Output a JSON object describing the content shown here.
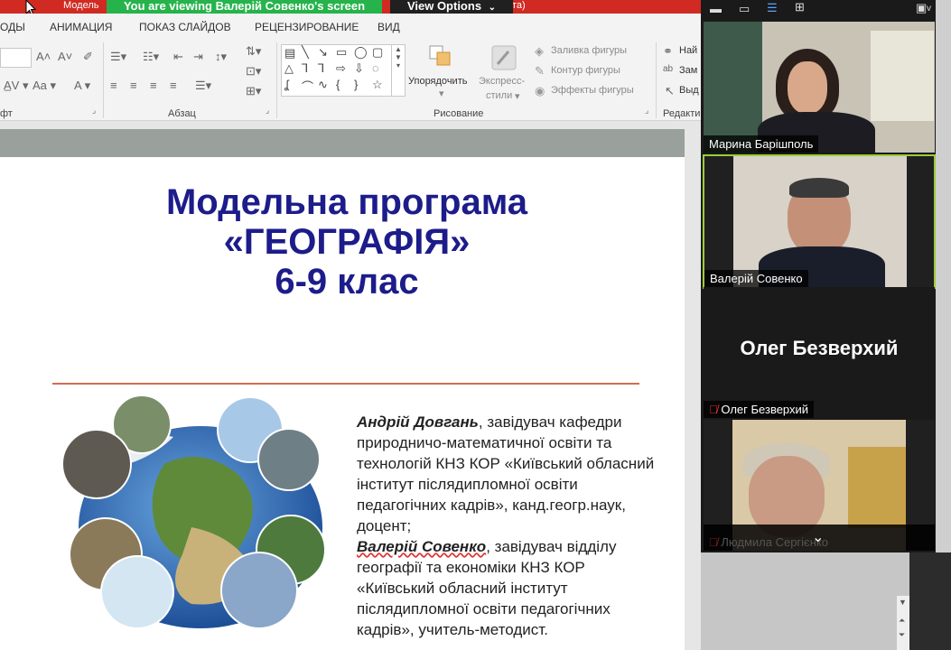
{
  "titlebar": {
    "left_text": "Модель",
    "right_text": "кта)"
  },
  "share": {
    "banner": "You are viewing Валерій Совенко's screen",
    "view_options": "View Options"
  },
  "ribbon": {
    "tabs": [
      "ОДЫ",
      "АНИМАЦИЯ",
      "ПОКАЗ СЛАЙДОВ",
      "РЕЦЕНЗИРОВАНИЕ",
      "ВИД"
    ],
    "groups": {
      "font_label": "фт",
      "paragraph_label": "Абзац",
      "drawing_label": "Рисование",
      "edit_label": "Редакти"
    },
    "buttons": {
      "arrange": "Упорядочить",
      "quick_styles_1": "Экспресс-",
      "quick_styles_2": "стили",
      "shape_fill": "Заливка фигуры",
      "shape_outline": "Контур фигуры",
      "shape_effects": "Эффекты фигуры",
      "find": "Най",
      "replace": "Зам",
      "select": "Выд"
    }
  },
  "slide": {
    "title_line1": "Модельна програма",
    "title_line2": "«ГЕОГРАФІЯ»",
    "title_line3": "6-9 клас",
    "author1_name": "Андрій Довгань",
    "author1_desc": ", завідувач кафедри природничо-математичної освіти та технологій КНЗ КОР «Київський обласний інститут післядипломної освіти педагогічних кадрів», канд.геогр.наук, доцент;",
    "author2_name": "Валерій Совенко",
    "author2_desc": ", завідувач відділу географії та економіки КНЗ КОР «Київський обласний інститут післядипломної освіти педагогічних кадрів», учитель-методист."
  },
  "zoom": {
    "participants": [
      {
        "name": "Марина Барішполь",
        "muted": false
      },
      {
        "name": "Валерій Совенко",
        "muted": false,
        "active_speaker": true
      },
      {
        "name": "Олег Безверхий",
        "muted": true,
        "video_off": true,
        "big_name": "Олег Безверхий"
      },
      {
        "name": "Людмила Сергієнко",
        "muted": true
      }
    ],
    "top_chevron": "v"
  },
  "colors": {
    "share_banner": "#27b34c",
    "titlebar": "#d02a23",
    "slide_title": "#1c1c8a",
    "active_border": "#9ccc3a"
  }
}
